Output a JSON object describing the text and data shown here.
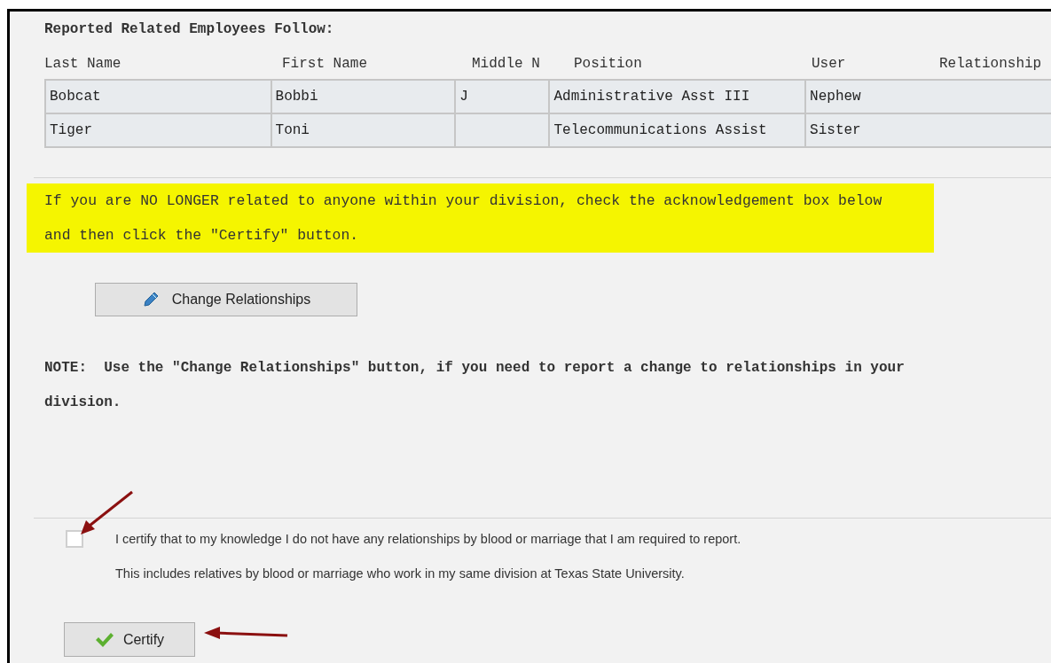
{
  "section_title": "Reported Related Employees Follow:",
  "table": {
    "columns": [
      "Last Name",
      "First Name",
      "Middle N",
      "Position",
      "User",
      "Relationship"
    ],
    "rows": [
      {
        "cells": [
          "Bobcat",
          "Bobbi",
          "J",
          "Administrative Asst III",
          "Nephew"
        ]
      },
      {
        "cells": [
          "Tiger",
          "Toni",
          "",
          "Telecommunications Assist",
          "Sister"
        ]
      }
    ]
  },
  "notice": {
    "lines": [
      "If you are NO LONGER related to anyone within your division, check the acknowledgement box below",
      "and then click the \"Certify\" button."
    ]
  },
  "change_button": {
    "label": "Change Relationships"
  },
  "note": "NOTE:  Use the \"Change Relationships\" button, if you need to report a change to relationships in your division.",
  "certification": {
    "checked": false,
    "lines": [
      "I certify that to my knowledge I do not have any relationships by blood or marriage that I am required to report.",
      "This includes relatives by blood or marriage who work in my same division at Texas State University."
    ]
  },
  "certify_button": {
    "label": "Certify"
  }
}
